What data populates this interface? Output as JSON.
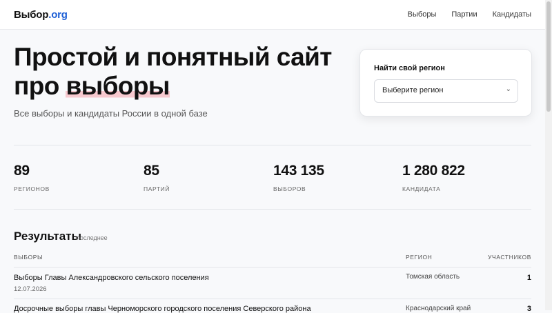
{
  "header": {
    "logo_main": "Выбор",
    "logo_tld": ".org",
    "nav": [
      "Выборы",
      "Партии",
      "Кандидаты"
    ]
  },
  "hero": {
    "title_line1": "Простой и понятный сайт",
    "title_line2_prefix": "про ",
    "title_line2_highlight": "выборы",
    "subtitle": "Все выборы и кандидаты России в одной базе"
  },
  "region_card": {
    "label": "Найти свой регион",
    "select_value": "Выберите регион"
  },
  "stats": [
    {
      "value": "89",
      "caption": "РЕГИОНОВ"
    },
    {
      "value": "85",
      "caption": "ПАРТИЙ"
    },
    {
      "value": "143 135",
      "caption": "ВЫБОРОВ"
    },
    {
      "value": "1 280 822",
      "caption": "КАНДИДАТА"
    }
  ],
  "results": {
    "title": "Результаты",
    "tag": "последнее",
    "columns": {
      "elections": "ВЫБОРЫ",
      "region": "РЕГИОН",
      "participants": "УЧАСТНИКОВ"
    },
    "rows": [
      {
        "title": "Выборы Главы Александровского сельского поселения",
        "date": "12.07.2026",
        "region": "Томская область",
        "count": "1"
      },
      {
        "title": "Досрочные выборы главы Черноморского городского поселения Северского района",
        "date": "",
        "region": "Краснодарский край",
        "count": "3"
      }
    ]
  },
  "colors": {
    "accent": "#1d5fd6",
    "highlight": "#f7c9cf",
    "background": "#f8f9fb"
  }
}
